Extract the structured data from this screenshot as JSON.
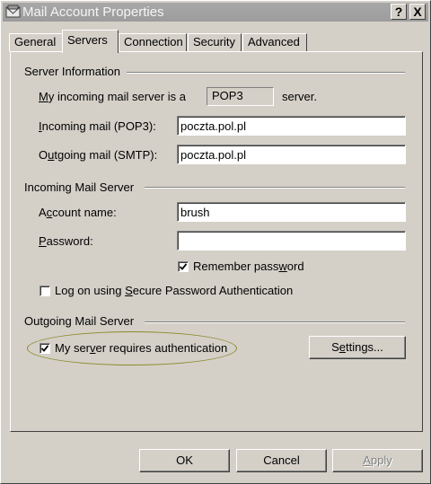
{
  "window": {
    "title": "Mail Account Properties",
    "help_btn": "?",
    "close_btn": "X"
  },
  "tabs": [
    {
      "label": "General"
    },
    {
      "label": "Servers"
    },
    {
      "label": "Connection"
    },
    {
      "label": "Security"
    },
    {
      "label": "Advanced"
    }
  ],
  "server_info": {
    "group_title": "Server Information",
    "server_type_prefix_u": "M",
    "server_type_prefix_rest": "y incoming mail server is a",
    "server_type_value": "POP3",
    "server_type_suffix": "server.",
    "incoming_label_u": "I",
    "incoming_label_rest": "ncoming mail (POP3):",
    "incoming_value": "poczta.pol.pl",
    "outgoing_label_pre": "O",
    "outgoing_label_u": "u",
    "outgoing_label_rest": "tgoing mail (SMTP):",
    "outgoing_value": "poczta.pol.pl"
  },
  "incoming_server": {
    "group_title": "Incoming Mail Server",
    "account_label_pre": "A",
    "account_label_u": "c",
    "account_label_rest": "count name:",
    "account_value": "brush",
    "password_label_u": "P",
    "password_label_rest": "assword:",
    "password_value": "",
    "remember_label_pre": "Remember pass",
    "remember_label_u": "w",
    "remember_label_rest": "ord",
    "remember_checked": true,
    "spa_label_pre": "Log on using ",
    "spa_label_u": "S",
    "spa_label_rest": "ecure Password Authentication",
    "spa_checked": false
  },
  "outgoing_server": {
    "group_title": "Outgoing Mail Server",
    "auth_label_pre": "My ser",
    "auth_label_u": "v",
    "auth_label_rest": "er requires authentication",
    "auth_checked": true,
    "settings_pre": "S",
    "settings_u": "e",
    "settings_rest": "ttings..."
  },
  "footer": {
    "ok": "OK",
    "cancel": "Cancel",
    "apply_u": "A",
    "apply_rest": "pply"
  }
}
